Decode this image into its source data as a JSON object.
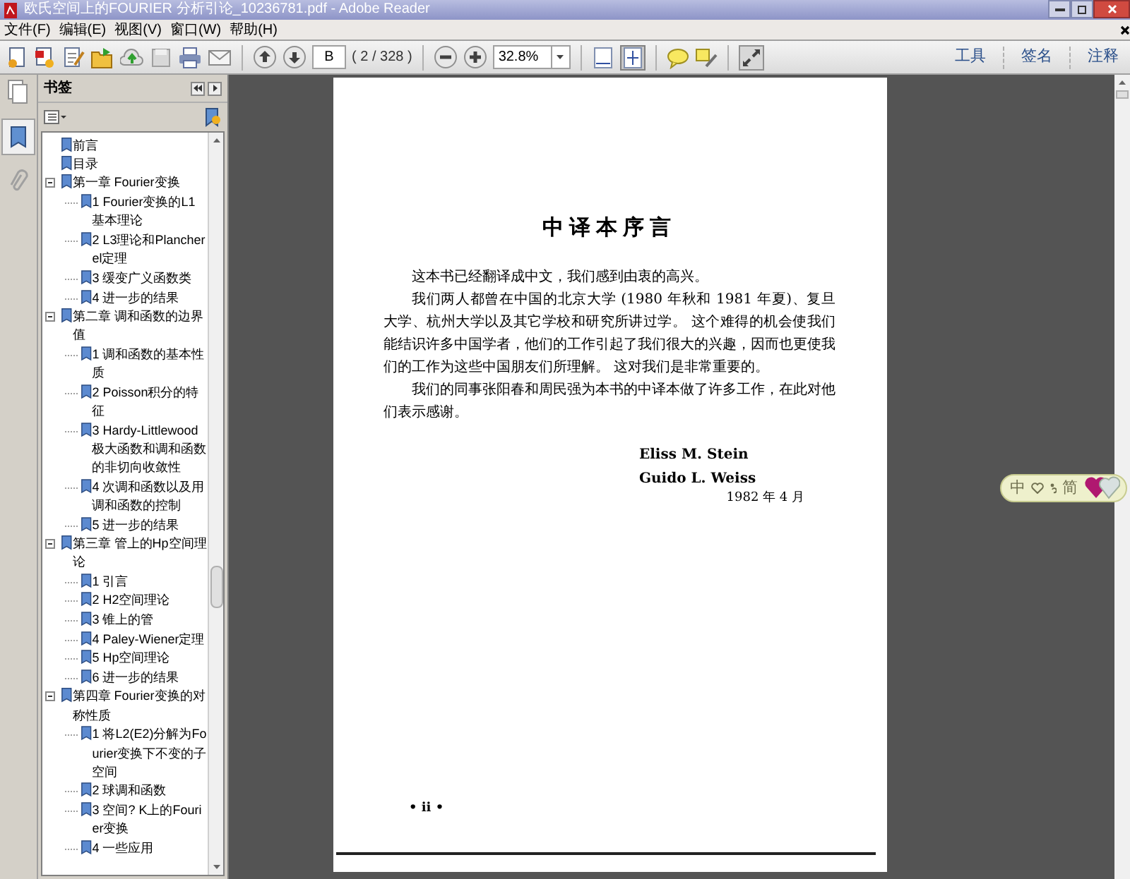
{
  "window": {
    "title": "欧氏空间上的FOURIER 分析引论_10236781.pdf - Adobe Reader"
  },
  "menu": [
    "文件(F)",
    "编辑(E)",
    "视图(V)",
    "窗口(W)",
    "帮助(H)"
  ],
  "toolbar": {
    "page_field": {
      "value": "B"
    },
    "page_count": "( 2 / 328 )",
    "zoom_field": {
      "value": "32.8%"
    },
    "links": [
      "工具",
      "签名",
      "注释"
    ]
  },
  "bookmarks_panel": {
    "title": "书签",
    "items": [
      {
        "label": "前言"
      },
      {
        "label": "目录"
      },
      {
        "label": "第一章 Fourier变换",
        "expanded": true,
        "children": [
          {
            "label": "1 Fourier变换的L1基本理论"
          },
          {
            "label": "2 L3理论和Plancherel定理"
          },
          {
            "label": "3 缓变广义函数类"
          },
          {
            "label": "4 进一步的结果"
          }
        ]
      },
      {
        "label": "第二章 调和函数的边界值",
        "expanded": true,
        "children": [
          {
            "label": "1 调和函数的基本性质"
          },
          {
            "label": "2 Poisson积分的特征"
          },
          {
            "label": "3 Hardy-Littlewood极大函数和调和函数的非切向收敛性"
          },
          {
            "label": "4 次调和函数以及用调和函数的控制"
          },
          {
            "label": "5 进一步的结果"
          }
        ]
      },
      {
        "label": "第三章 管上的Hp空间理论",
        "expanded": true,
        "children": [
          {
            "label": "1 引言"
          },
          {
            "label": "2 H2空间理论"
          },
          {
            "label": "3 锥上的管"
          },
          {
            "label": "4 Paley-Wiener定理"
          },
          {
            "label": "5 Hp空间理论"
          },
          {
            "label": "6 进一步的结果"
          }
        ]
      },
      {
        "label": "第四章 Fourier变换的对称性质",
        "expanded": true,
        "children": [
          {
            "label": "1 将L2(E2)分解为Fourier变换下不变的子空间"
          },
          {
            "label": "2 球调和函数"
          },
          {
            "label": "3 空间? K上的Fourier变换"
          },
          {
            "label": "4 一些应用"
          }
        ]
      }
    ]
  },
  "page": {
    "heading": "中译本序言",
    "paragraphs": [
      "这本书已经翻译成中文，我们感到由衷的高兴。",
      "我们两人都曾在中国的北京大学 (1980 年秋和 1981 年夏)、复旦大学、杭州大学以及其它学校和研究所讲过学。 这个难得的机会使我们能结识许多中国学者，他们的工作引起了我们很大的兴趣，因而也更使我们的工作为这些中国朋友们所理解。 这对我们是非常重要的。",
      "我们的同事张阳春和周民强为本书的中译本做了许多工作，在此对他们表示感谢。"
    ],
    "signatures": [
      "Eliss M. Stein",
      "Guido L. Weiss"
    ],
    "date": "1982 年 4 月",
    "page_number": "• ii •"
  },
  "ime_bar": {
    "left_label": "中",
    "right_label": "简"
  }
}
